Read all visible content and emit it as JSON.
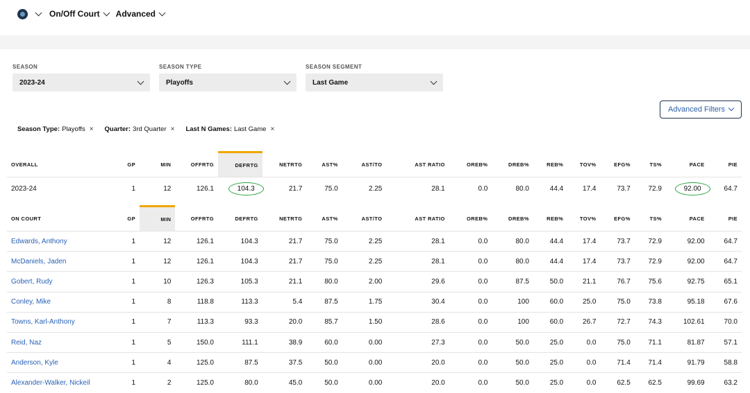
{
  "nav": {
    "team_icon": "timberwolves-logo-icon",
    "item1": "On/Off Court",
    "item2": "Advanced"
  },
  "filters": {
    "season": {
      "label": "SEASON",
      "value": "2023-24"
    },
    "season_type": {
      "label": "SEASON TYPE",
      "value": "Playoffs"
    },
    "season_segment": {
      "label": "SEASON SEGMENT",
      "value": "Last Game"
    }
  },
  "advanced_filters_label": "Advanced Filters",
  "chips": [
    {
      "key": "Season Type:",
      "value": "Playoffs"
    },
    {
      "key": "Quarter:",
      "value": "3rd Quarter"
    },
    {
      "key": "Last N Games:",
      "value": "Last Game"
    }
  ],
  "chip_close": "×",
  "columns": [
    "GP",
    "MIN",
    "OFFRTG",
    "DEFRTG",
    "NETRTG",
    "AST%",
    "AST/TO",
    "AST RATIO",
    "OREB%",
    "DREB%",
    "REB%",
    "TOV%",
    "EFG%",
    "TS%",
    "PACE",
    "PIE"
  ],
  "overall": {
    "header": "OVERALL",
    "row": [
      "2023-24",
      "1",
      "12",
      "126.1",
      "104.3",
      "21.7",
      "75.0",
      "2.25",
      "28.1",
      "0.0",
      "80.0",
      "44.4",
      "17.4",
      "73.7",
      "72.9",
      "92.00",
      "64.7"
    ]
  },
  "on_court": {
    "header": "ON COURT",
    "rows": [
      [
        "Edwards, Anthony",
        "1",
        "12",
        "126.1",
        "104.3",
        "21.7",
        "75.0",
        "2.25",
        "28.1",
        "0.0",
        "80.0",
        "44.4",
        "17.4",
        "73.7",
        "72.9",
        "92.00",
        "64.7"
      ],
      [
        "McDaniels, Jaden",
        "1",
        "12",
        "126.1",
        "104.3",
        "21.7",
        "75.0",
        "2.25",
        "28.1",
        "0.0",
        "80.0",
        "44.4",
        "17.4",
        "73.7",
        "72.9",
        "92.00",
        "64.7"
      ],
      [
        "Gobert, Rudy",
        "1",
        "10",
        "126.3",
        "105.3",
        "21.1",
        "80.0",
        "2.00",
        "29.6",
        "0.0",
        "87.5",
        "50.0",
        "21.1",
        "76.7",
        "75.6",
        "92.75",
        "65.1"
      ],
      [
        "Conley, Mike",
        "1",
        "8",
        "118.8",
        "113.3",
        "5.4",
        "87.5",
        "1.75",
        "30.4",
        "0.0",
        "100",
        "60.0",
        "25.0",
        "75.0",
        "73.8",
        "95.18",
        "67.6"
      ],
      [
        "Towns, Karl-Anthony",
        "1",
        "7",
        "113.3",
        "93.3",
        "20.0",
        "85.7",
        "1.50",
        "28.6",
        "0.0",
        "100",
        "60.0",
        "26.7",
        "72.7",
        "74.3",
        "102.61",
        "70.0"
      ],
      [
        "Reid, Naz",
        "1",
        "5",
        "150.0",
        "111.1",
        "38.9",
        "60.0",
        "0.00",
        "27.3",
        "0.0",
        "50.0",
        "25.0",
        "0.0",
        "75.0",
        "71.1",
        "81.87",
        "57.1"
      ],
      [
        "Anderson, Kyle",
        "1",
        "4",
        "125.0",
        "87.5",
        "37.5",
        "50.0",
        "0.00",
        "20.0",
        "0.0",
        "50.0",
        "25.0",
        "0.0",
        "71.4",
        "71.4",
        "91.79",
        "58.8"
      ],
      [
        "Alexander-Walker, Nickeil",
        "1",
        "2",
        "125.0",
        "80.0",
        "45.0",
        "50.0",
        "0.00",
        "20.0",
        "0.0",
        "50.0",
        "25.0",
        "0.0",
        "62.5",
        "62.5",
        "99.69",
        "63.2"
      ]
    ]
  },
  "colors": {
    "accent": "#f0a600",
    "link": "#2a62b5",
    "highlight_circle": "#2aa33d"
  }
}
